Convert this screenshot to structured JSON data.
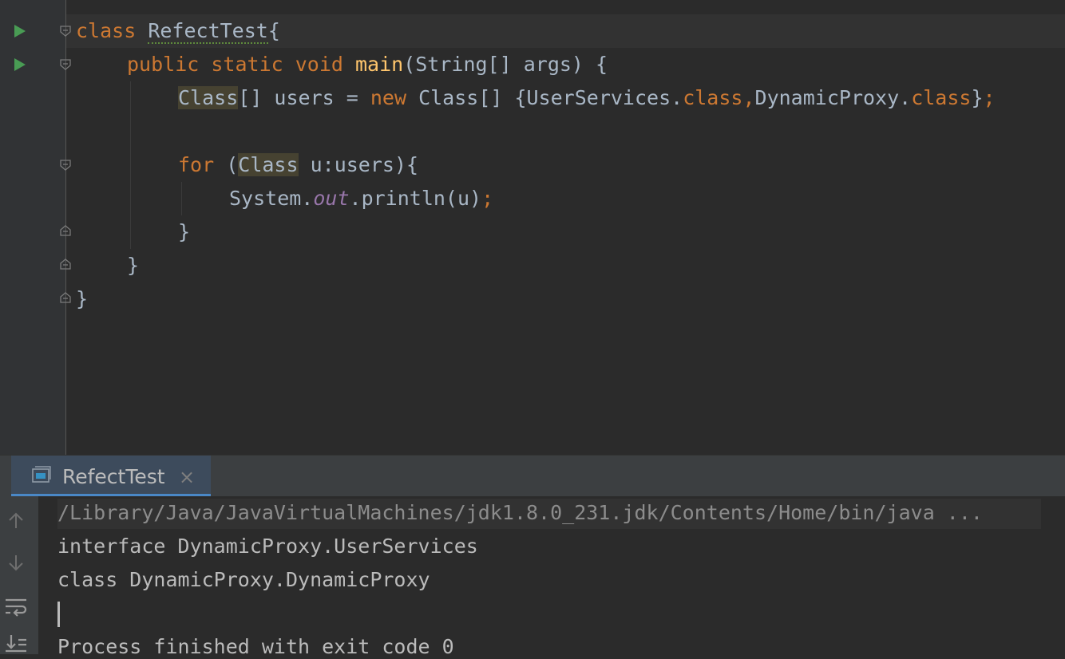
{
  "editor": {
    "lines": {
      "l1": {
        "kw_class": "class ",
        "class_name": "RefectTest",
        "brace": "{"
      },
      "l2": {
        "kw_public": "public ",
        "kw_static": "static ",
        "kw_void": "void ",
        "fn_main": "main",
        "params": "(String[] args) {"
      },
      "l3": {
        "type_class": "Class",
        "decl": "[] users = ",
        "kw_new": "new ",
        "init": "Class[] {UserServices.",
        "kw_class1": "class",
        "comma": ",",
        "dyn": "DynamicProxy.",
        "kw_class2": "class",
        "close": "}",
        "semi": ";"
      },
      "l4": {
        "kw_for": "for ",
        "paren": "(",
        "type_class": "Class",
        "rest": " u:users){"
      },
      "l5": {
        "system": "System.",
        "field_out": "out",
        "println": ".println(u)",
        "semi": ";"
      },
      "l6": {
        "brace": "}"
      },
      "l7": {
        "brace": "}"
      },
      "l8": {
        "brace": "}"
      }
    }
  },
  "run_window": {
    "tab": {
      "title": "RefectTest",
      "close": "×"
    },
    "console": {
      "command": "/Library/Java/JavaVirtualMachines/jdk1.8.0_231.jdk/Contents/Home/bin/java ...",
      "output": [
        "interface DynamicProxy.UserServices",
        "class DynamicProxy.DynamicProxy"
      ],
      "exit_message": "Process finished with exit code 0"
    }
  },
  "colors": {
    "background": "#2b2b2b",
    "keyword": "#cc7832",
    "function": "#ffc66d",
    "static_field": "#9876aa",
    "default_text": "#a9b7c6",
    "run_icon": "#499c54",
    "tab_accent": "#4a88c7"
  },
  "icons": {
    "run_gutter": "run-triangle-icon",
    "fold": "fold-marker-icon",
    "console_tab": "console-icon",
    "up": "arrow-up-icon",
    "down": "arrow-down-icon",
    "soft_wrap": "soft-wrap-icon",
    "scroll_end": "scroll-to-end-icon"
  }
}
